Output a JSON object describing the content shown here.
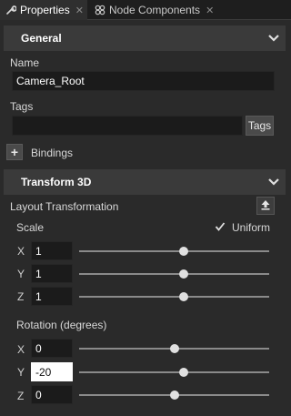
{
  "tabs": [
    {
      "label": "Properties",
      "icon": "wrench-icon",
      "active": true
    },
    {
      "label": "Node Components",
      "icon": "components-icon",
      "active": false
    }
  ],
  "general": {
    "title": "General",
    "name_label": "Name",
    "name_value": "Camera_Root",
    "tags_label": "Tags",
    "tags_value": "",
    "tags_button": "Tags",
    "bindings_button": "+",
    "bindings_label": "Bindings"
  },
  "transform": {
    "title": "Transform 3D",
    "layout_label": "Layout Transformation",
    "scale_label": "Scale",
    "uniform_label": "Uniform",
    "uniform_checked": true,
    "scale": [
      {
        "axis": "X",
        "value": "1",
        "slider": 0.55
      },
      {
        "axis": "Y",
        "value": "1",
        "slider": 0.55
      },
      {
        "axis": "Z",
        "value": "1",
        "slider": 0.55
      }
    ],
    "rotation_label": "Rotation (degrees)",
    "rotation": [
      {
        "axis": "X",
        "value": "0",
        "slider": 0.5
      },
      {
        "axis": "Y",
        "value": "-20",
        "slider": 0.55,
        "focused": true
      },
      {
        "axis": "Z",
        "value": "0",
        "slider": 0.5
      }
    ]
  },
  "colors": {
    "background": "#2a2a2a",
    "section_header": "#3a3a3a",
    "input_bg": "#1b1b1b"
  }
}
